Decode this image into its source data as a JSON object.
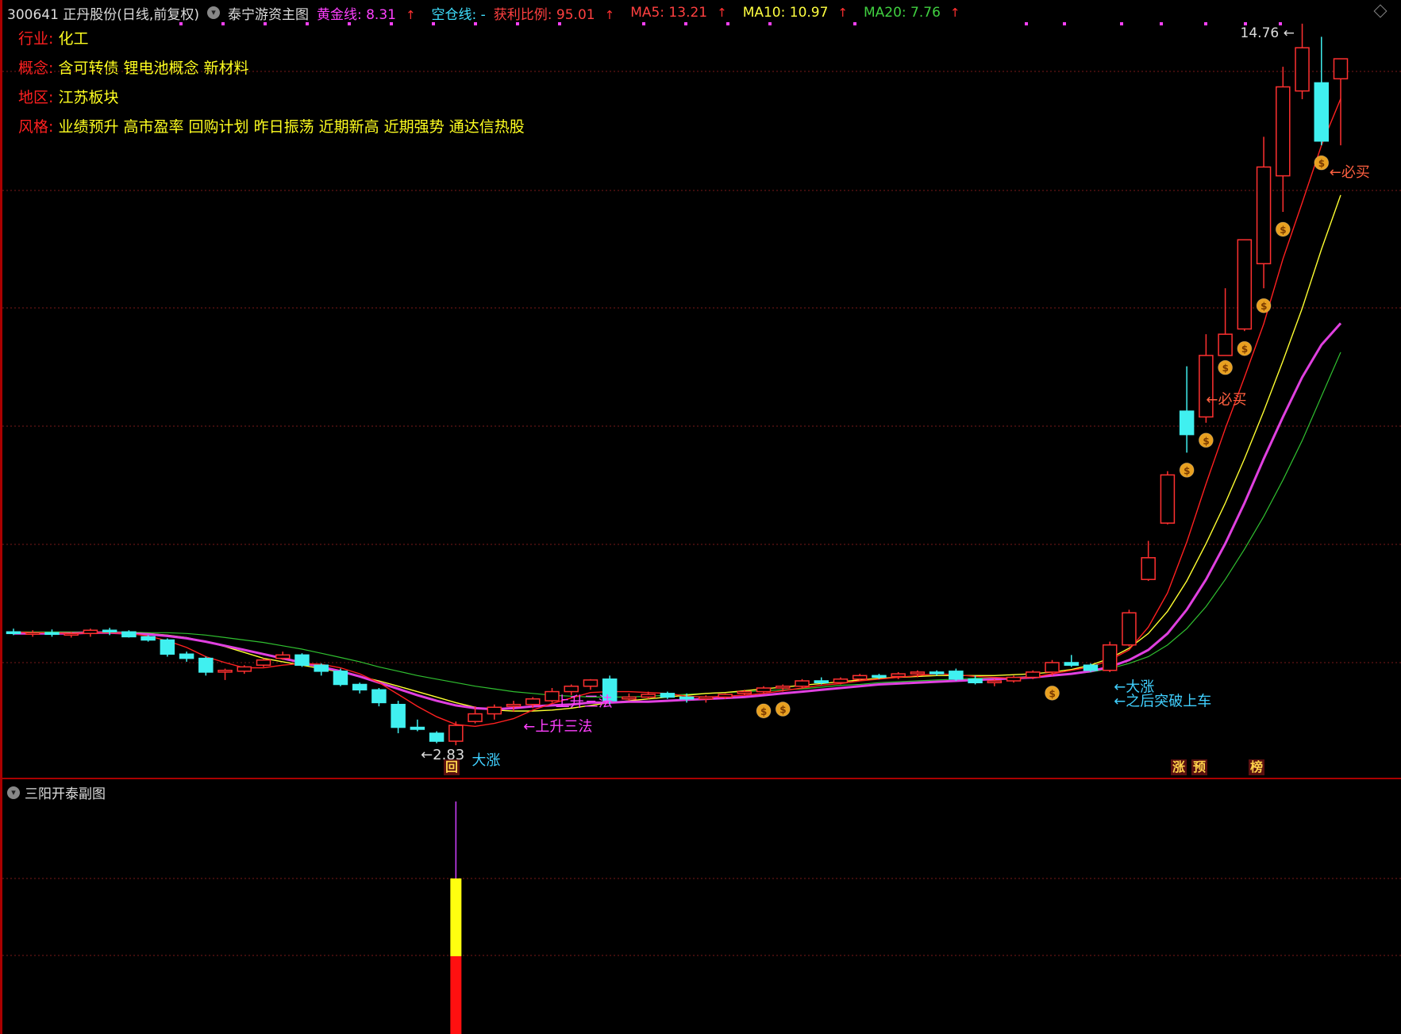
{
  "header": {
    "code_name": "300641 正丹股份(日线,前复权)",
    "template": "泰宁游资主图",
    "gold_line": "黄金线: 8.31",
    "empty_line": "空仓线: -",
    "profit_ratio": "获利比例: 95.01",
    "ma5": "MA5: 13.21",
    "ma10": "MA10: 10.97",
    "ma20": "MA20: 7.76",
    "colors": {
      "gold": "#ff40ff",
      "empty": "#40e0ff",
      "profit": "#ff4040",
      "ma5": "#ff4040",
      "ma10": "#ffff40",
      "ma20": "#40d040"
    }
  },
  "info": [
    {
      "key": "行业:",
      "value": "化工"
    },
    {
      "key": "概念:",
      "value": "含可转债 锂电池概念 新材料"
    },
    {
      "key": "地区:",
      "value": "江苏板块"
    },
    {
      "key": "风格:",
      "value": "业绩预升 高市盈率 回购计划 昨日振荡 近期新高 近期强势 通达信热股"
    }
  ],
  "markers": {
    "hui": "回",
    "zhang": "涨",
    "yu": "预",
    "bang": "榜"
  },
  "sub_panel": {
    "title": "三阳开泰副图"
  },
  "chart_data": {
    "type": "candlestick",
    "title": "",
    "price_max_label": "14.76",
    "price_min_label": "2.83",
    "candles": [
      [
        3.42,
        3.46,
        3.38,
        3.4
      ],
      [
        3.4,
        3.44,
        3.36,
        3.41
      ],
      [
        3.41,
        3.45,
        3.36,
        3.39
      ],
      [
        3.39,
        3.42,
        3.35,
        3.4
      ],
      [
        3.4,
        3.46,
        3.36,
        3.44
      ],
      [
        3.44,
        3.47,
        3.38,
        3.42
      ],
      [
        3.42,
        3.44,
        3.35,
        3.36
      ],
      [
        3.36,
        3.38,
        3.3,
        3.32
      ],
      [
        3.32,
        3.34,
        3.12,
        3.15
      ],
      [
        3.15,
        3.18,
        3.06,
        3.1
      ],
      [
        3.1,
        3.12,
        2.9,
        2.94
      ],
      [
        2.94,
        2.98,
        2.85,
        2.96
      ],
      [
        2.95,
        3.02,
        2.92,
        3.0
      ],
      [
        3.02,
        3.1,
        3.0,
        3.08
      ],
      [
        3.1,
        3.18,
        3.08,
        3.14
      ],
      [
        3.14,
        3.16,
        3.0,
        3.02
      ],
      [
        3.02,
        3.04,
        2.9,
        2.95
      ],
      [
        2.95,
        2.98,
        2.78,
        2.8
      ],
      [
        2.8,
        2.82,
        2.7,
        2.74
      ],
      [
        2.74,
        2.76,
        2.56,
        2.6
      ],
      [
        2.58,
        2.62,
        2.28,
        2.34
      ],
      [
        2.34,
        2.42,
        2.3,
        2.32
      ],
      [
        2.28,
        2.3,
        2.18,
        2.2
      ],
      [
        2.2,
        2.4,
        2.16,
        2.36
      ],
      [
        2.4,
        2.56,
        2.38,
        2.48
      ],
      [
        2.48,
        2.58,
        2.42,
        2.55
      ],
      [
        2.56,
        2.62,
        2.5,
        2.58
      ],
      [
        2.58,
        2.66,
        2.54,
        2.64
      ],
      [
        2.62,
        2.76,
        2.6,
        2.72
      ],
      [
        2.72,
        2.8,
        2.68,
        2.78
      ],
      [
        2.78,
        2.86,
        2.74,
        2.85
      ],
      [
        2.86,
        2.9,
        2.58,
        2.62
      ],
      [
        2.64,
        2.7,
        2.62,
        2.66
      ],
      [
        2.66,
        2.72,
        2.64,
        2.69
      ],
      [
        2.7,
        2.72,
        2.64,
        2.66
      ],
      [
        2.66,
        2.7,
        2.6,
        2.64
      ],
      [
        2.64,
        2.68,
        2.6,
        2.66
      ],
      [
        2.66,
        2.7,
        2.64,
        2.69
      ],
      [
        2.7,
        2.74,
        2.68,
        2.72
      ],
      [
        2.72,
        2.78,
        2.7,
        2.76
      ],
      [
        2.76,
        2.8,
        2.72,
        2.78
      ],
      [
        2.78,
        2.86,
        2.76,
        2.84
      ],
      [
        2.84,
        2.88,
        2.8,
        2.82
      ],
      [
        2.82,
        2.88,
        2.8,
        2.86
      ],
      [
        2.86,
        2.92,
        2.84,
        2.9
      ],
      [
        2.9,
        2.92,
        2.86,
        2.89
      ],
      [
        2.89,
        2.94,
        2.86,
        2.92
      ],
      [
        2.92,
        2.96,
        2.88,
        2.94
      ],
      [
        2.94,
        2.96,
        2.9,
        2.93
      ],
      [
        2.95,
        2.98,
        2.84,
        2.86
      ],
      [
        2.86,
        2.9,
        2.8,
        2.82
      ],
      [
        2.82,
        2.86,
        2.78,
        2.84
      ],
      [
        2.84,
        2.9,
        2.82,
        2.88
      ],
      [
        2.88,
        2.96,
        2.86,
        2.94
      ],
      [
        2.94,
        3.08,
        2.9,
        3.05
      ],
      [
        3.05,
        3.14,
        3.0,
        3.02
      ],
      [
        3.02,
        3.04,
        2.94,
        2.96
      ],
      [
        2.96,
        3.3,
        2.94,
        3.26
      ],
      [
        3.26,
        3.7,
        3.24,
        3.66
      ],
      [
        4.1,
        4.64,
        4.08,
        4.4
      ],
      [
        4.9,
        5.7,
        4.88,
        5.64
      ],
      [
        6.7,
        7.5,
        6.0,
        6.3
      ],
      [
        6.6,
        8.1,
        6.5,
        7.7
      ],
      [
        7.7,
        9.0,
        7.8,
        8.1
      ],
      [
        8.2,
        10.0,
        8.16,
        10.0
      ],
      [
        9.5,
        12.3,
        9.0,
        11.6
      ],
      [
        11.4,
        14.0,
        10.6,
        13.5
      ],
      [
        13.4,
        15.1,
        13.2,
        14.48
      ],
      [
        13.6,
        14.76,
        12.1,
        12.2
      ],
      [
        13.7,
        14.2,
        12.1,
        14.2
      ]
    ],
    "ma5": [
      3.42,
      3.41,
      3.41,
      3.4,
      3.41,
      3.41,
      3.4,
      3.37,
      3.31,
      3.23,
      3.12,
      3.05,
      2.99,
      2.99,
      3.02,
      3.04,
      3.03,
      2.99,
      2.92,
      2.82,
      2.69,
      2.56,
      2.45,
      2.37,
      2.35,
      2.38,
      2.43,
      2.52,
      2.59,
      2.65,
      2.71,
      2.72,
      2.72,
      2.71,
      2.7,
      2.67,
      2.66,
      2.67,
      2.68,
      2.7,
      2.73,
      2.76,
      2.79,
      2.81,
      2.84,
      2.86,
      2.88,
      2.9,
      2.92,
      2.91,
      2.89,
      2.88,
      2.87,
      2.88,
      2.92,
      2.96,
      3.0,
      3.08,
      3.2,
      3.48,
      3.92,
      4.62,
      5.5,
      6.4,
      7.3,
      8.3,
      9.6,
      10.8,
      12.1,
      13.21
    ],
    "ma10": [
      3.42,
      3.41,
      3.41,
      3.41,
      3.41,
      3.41,
      3.41,
      3.4,
      3.38,
      3.35,
      3.3,
      3.24,
      3.17,
      3.1,
      3.06,
      3.02,
      2.98,
      2.94,
      2.89,
      2.84,
      2.78,
      2.72,
      2.66,
      2.6,
      2.55,
      2.52,
      2.51,
      2.51,
      2.52,
      2.54,
      2.57,
      2.6,
      2.62,
      2.64,
      2.66,
      2.68,
      2.7,
      2.71,
      2.73,
      2.75,
      2.77,
      2.79,
      2.81,
      2.83,
      2.85,
      2.87,
      2.88,
      2.89,
      2.9,
      2.9,
      2.9,
      2.9,
      2.91,
      2.92,
      2.94,
      2.97,
      3.02,
      3.1,
      3.22,
      3.4,
      3.68,
      4.08,
      4.6,
      5.2,
      5.9,
      6.7,
      7.6,
      8.6,
      9.8,
      10.97
    ],
    "ma20": [
      3.42,
      3.42,
      3.42,
      3.42,
      3.42,
      3.42,
      3.42,
      3.41,
      3.41,
      3.4,
      3.38,
      3.35,
      3.32,
      3.29,
      3.25,
      3.21,
      3.16,
      3.11,
      3.06,
      3.0,
      2.95,
      2.9,
      2.86,
      2.82,
      2.78,
      2.75,
      2.72,
      2.7,
      2.68,
      2.67,
      2.66,
      2.66,
      2.66,
      2.67,
      2.68,
      2.69,
      2.7,
      2.71,
      2.72,
      2.73,
      2.74,
      2.75,
      2.77,
      2.79,
      2.8,
      2.82,
      2.83,
      2.84,
      2.85,
      2.86,
      2.87,
      2.87,
      2.88,
      2.89,
      2.9,
      2.92,
      2.94,
      2.98,
      3.04,
      3.12,
      3.26,
      3.46,
      3.74,
      4.1,
      4.52,
      5.0,
      5.56,
      6.2,
      6.96,
      7.76
    ],
    "gold": [
      3.4,
      3.4,
      3.4,
      3.4,
      3.41,
      3.41,
      3.4,
      3.39,
      3.37,
      3.34,
      3.3,
      3.25,
      3.2,
      3.15,
      3.1,
      3.05,
      3.0,
      2.95,
      2.89,
      2.82,
      2.75,
      2.68,
      2.62,
      2.57,
      2.54,
      2.53,
      2.54,
      2.56,
      2.57,
      2.58,
      2.6,
      2.6,
      2.61,
      2.61,
      2.62,
      2.63,
      2.64,
      2.65,
      2.66,
      2.68,
      2.7,
      2.72,
      2.74,
      2.76,
      2.78,
      2.8,
      2.81,
      2.82,
      2.83,
      2.84,
      2.85,
      2.86,
      2.87,
      2.88,
      2.9,
      2.92,
      2.95,
      3.0,
      3.08,
      3.2,
      3.4,
      3.7,
      4.1,
      4.6,
      5.2,
      5.9,
      6.6,
      7.3,
      7.9,
      8.31
    ],
    "annotations": [
      {
        "text": "←2.83",
        "i": 22
      },
      {
        "text": "大涨",
        "i": 23
      },
      {
        "text": "←上升三法",
        "i": 27
      },
      {
        "text": "上升三法",
        "i": 29
      },
      {
        "text": "←大涨",
        "i": 57
      },
      {
        "text": "←之后突破上车",
        "i": 57
      },
      {
        "text": "←必买",
        "i": 62
      },
      {
        "text": "←必买",
        "i": 68
      }
    ],
    "money_bags": [
      39,
      40,
      54,
      61,
      62,
      63,
      64,
      65,
      66,
      68
    ],
    "sub_bar": {
      "i": 23,
      "yellow": 0.5,
      "red": 0.5
    }
  }
}
